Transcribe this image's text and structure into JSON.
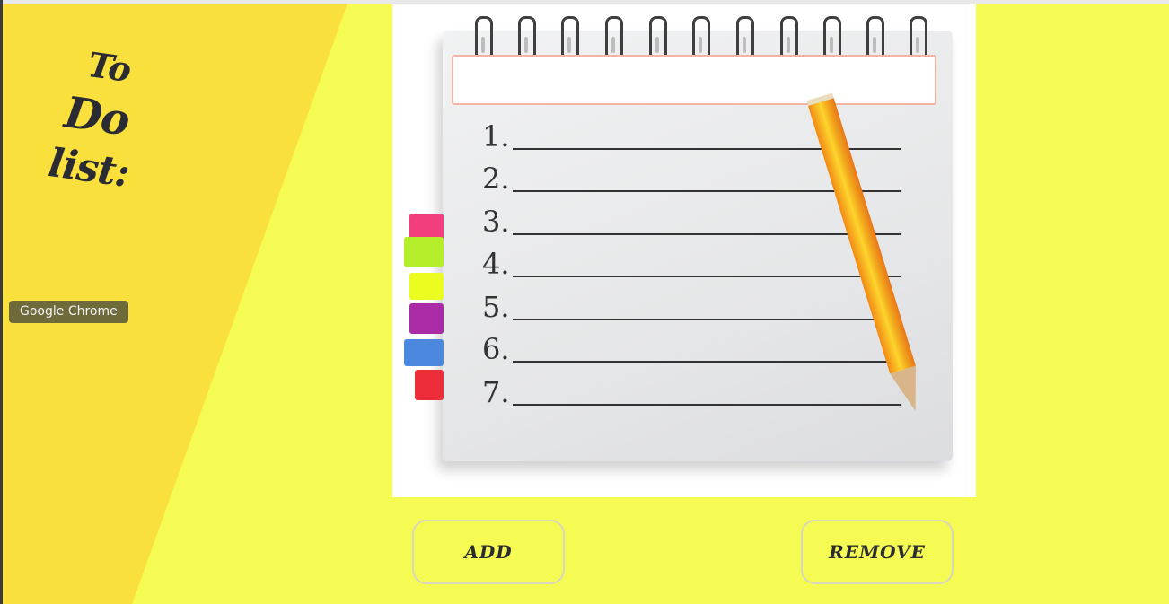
{
  "header": {
    "title_line1": "To",
    "title_line2": "Do",
    "title_line3": "list:"
  },
  "tooltip": {
    "text": "Google Chrome"
  },
  "notepad": {
    "task_input_value": "",
    "line_numbers": [
      "1.",
      "2.",
      "3.",
      "4.",
      "5.",
      "6.",
      "7."
    ]
  },
  "buttons": {
    "add_label": "ADD",
    "remove_label": "REMOVE"
  },
  "colors": {
    "background": "#f5fb52",
    "diagonal_panel": "#fae03c",
    "title_text": "#2b2b33",
    "input_border": "#f2b5a4"
  }
}
